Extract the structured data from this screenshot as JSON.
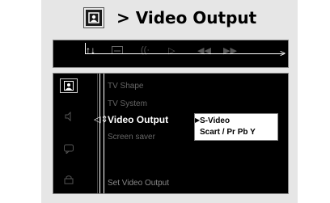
{
  "header": {
    "icon": "tv-screen-icon",
    "title": "> Video Output"
  },
  "toolbar": {
    "active_icon": "tools-icon",
    "icons": [
      "subtitle-icon",
      "audio-icon",
      "play-icon",
      "rewind-icon",
      "fast-forward-icon"
    ]
  },
  "sidebar": {
    "icons": [
      "tv-screen-icon",
      "speaker-icon",
      "subtitle-bubble-icon",
      "lock-icon"
    ],
    "selected_index": 0
  },
  "menu": {
    "items": [
      "TV Shape",
      "TV System",
      "Video Output",
      "Screen saver"
    ],
    "active_index": 2,
    "marker": "◁⇕"
  },
  "options": {
    "items": [
      "S-Video",
      "Scart / Pr Pb Y"
    ],
    "selected_index": 0
  },
  "status": {
    "text": "Set Video Output"
  },
  "colors": {
    "page_background": "#e6e6e6",
    "panel_background": "#000000",
    "active_text": "#ffffff",
    "inactive_text": "#666666"
  }
}
